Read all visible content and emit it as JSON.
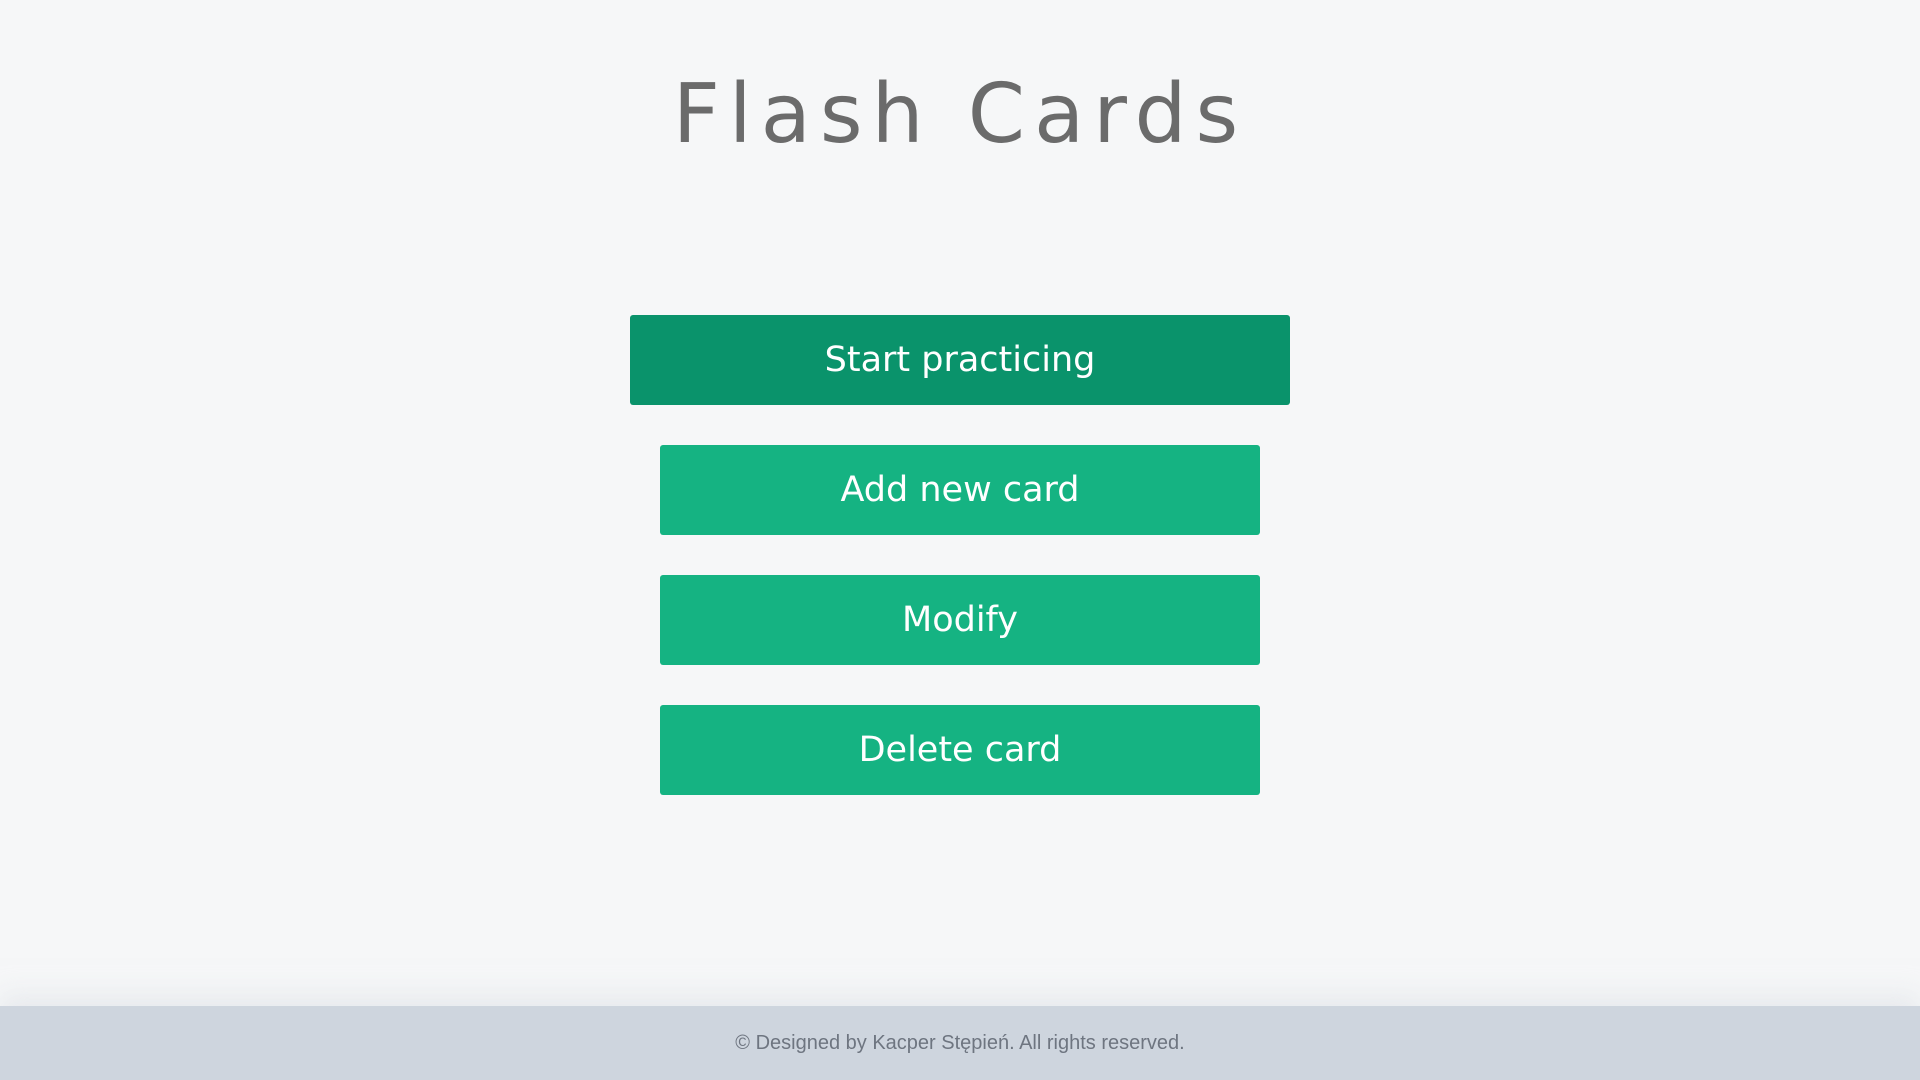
{
  "header": {
    "title": "Flash Cards"
  },
  "menu": {
    "start_label": "Start practicing",
    "add_label": "Add new card",
    "modify_label": "Modify",
    "delete_label": "Delete card"
  },
  "footer": {
    "text": "© Designed by Kacper Stępień. All rights reserved."
  },
  "colors": {
    "background": "#f6f7f8",
    "primary_button": "#0a936b",
    "secondary_button": "#15b382",
    "footer_background": "#ced5de",
    "title_text": "#6b6b6b"
  }
}
